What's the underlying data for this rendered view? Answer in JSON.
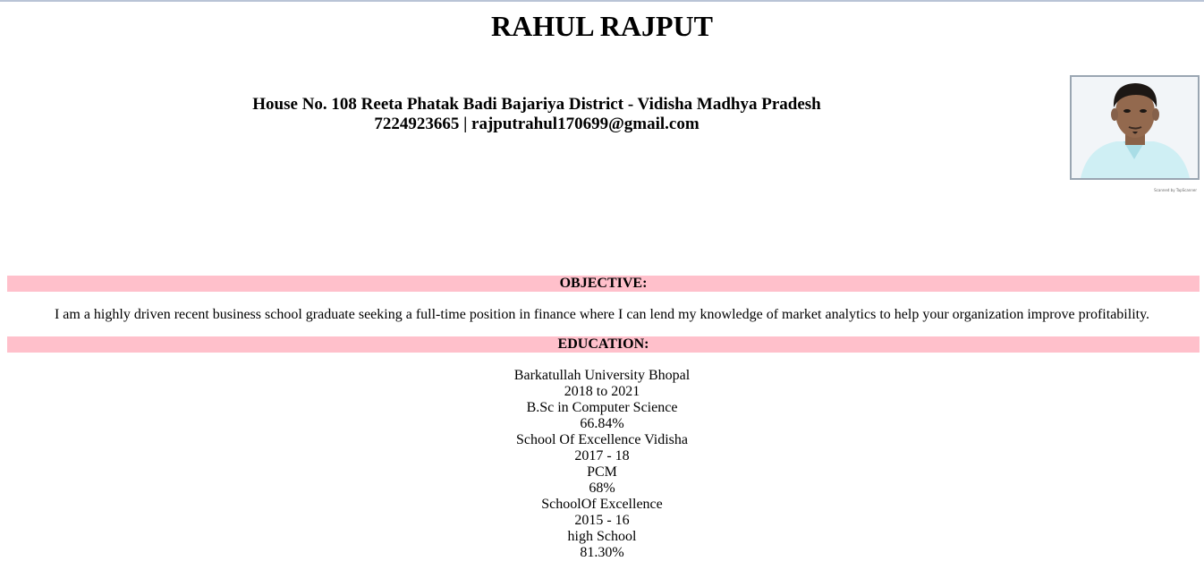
{
  "header": {
    "name": "RAHUL RAJPUT",
    "address": "House No. 108 Reeta Phatak Badi Bajariya District - Vidisha Madhya Pradesh",
    "contact_line": "7224923665 | rajputrahul170699@gmail.com",
    "photo_credit": "Scanned by TapScanner"
  },
  "objective": {
    "heading": "OBJECTIVE:",
    "text": "I am a highly driven recent business school graduate seeking a full-time position in finance where I can lend my knowledge of market analytics to help your organization improve profitability."
  },
  "education": {
    "heading": "EDUCATION:",
    "lines": [
      "Barkatullah University Bhopal",
      "2018 to 2021",
      "B.Sc in Computer Science",
      "66.84%",
      "School Of Excellence Vidisha",
      "2017 - 18",
      "PCM",
      "68%",
      "SchoolOf Excellence",
      "2015 - 16",
      "high School",
      "81.30%"
    ]
  },
  "colors": {
    "section_band": "#ffc0cb",
    "top_border": "#b9c4d6"
  }
}
